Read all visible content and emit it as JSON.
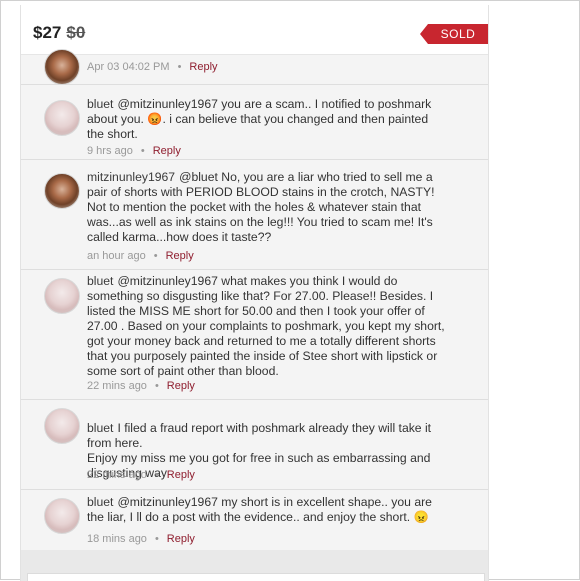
{
  "listing": {
    "price": "$27",
    "original_price": "$0",
    "sold_badge": "SOLD"
  },
  "comments": [
    {
      "user": "",
      "text": "",
      "time": "Apr 03 04:02 PM",
      "separator": "•",
      "reply": "Reply"
    },
    {
      "user": "bluet",
      "text": "@mitzinunley1967 you are a scam.. I notified to poshmark about you. 😡. i can believe that you changed and then painted the short.",
      "time": "9 hrs ago",
      "separator": "•",
      "reply": "Reply"
    },
    {
      "user": "mitzinunley1967",
      "text": "@bluet  No, you are a liar who tried to sell me a pair of shorts with PERIOD BLOOD stains in the crotch, NASTY! Not to mention the pocket with the holes & whatever stain that was...as well as ink stains on the leg!!!  You tried to scam me!  It's called karma...how does it taste??",
      "time": "an hour ago",
      "separator": "•",
      "reply": "Reply"
    },
    {
      "user": "bluet",
      "text": "@mitzinunley1967 what makes you think I would do something so disgusting like that? For 27.00. Please!! Besides. I listed the MISS ME short for 50.00 and then I took your offer of 27.00 . Based on your complaints to poshmark, you kept my short, got your money back and returned to me a totally different shorts that you purposely painted the inside of Stee short with lipstick or some sort of paint other than blood.",
      "time": "22 mins ago",
      "separator": "•",
      "reply": "Reply"
    },
    {
      "user": "bluet",
      "text": "I filed a fraud report with poshmark already they will take it from here.\nEnjoy my miss me you got for free in such as embarrassing and disgusting way",
      "time": "22 mins ago",
      "separator": "•",
      "reply": "Reply"
    },
    {
      "user": "bluet",
      "text": "@mitzinunley1967 my short is in excellent shape.. you are the liar, I ll do a post with the evidence.. and enjoy the short. 😠",
      "time": "18 mins ago",
      "separator": "•",
      "reply": "Reply"
    }
  ]
}
